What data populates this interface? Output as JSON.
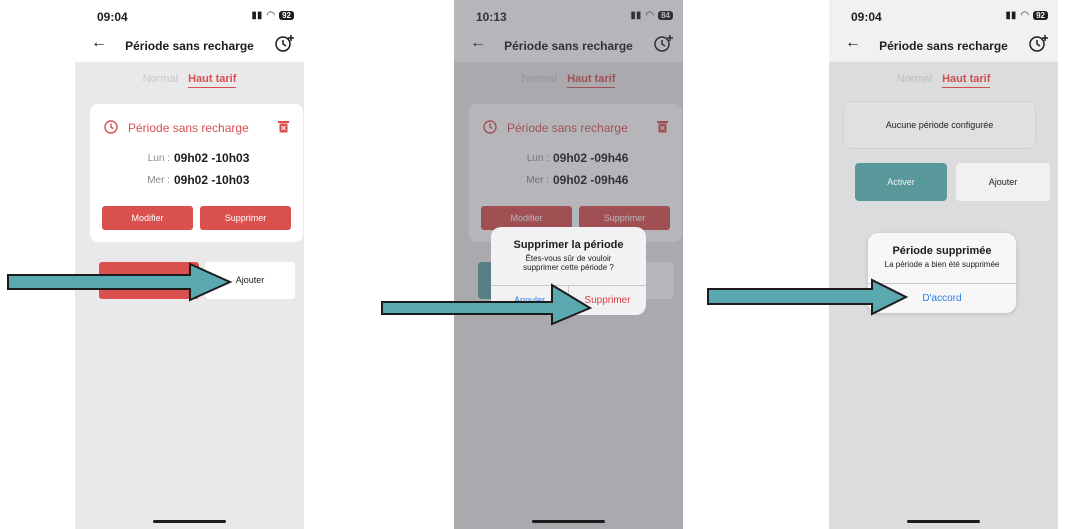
{
  "common": {
    "title": "Période sans recharge",
    "tab_normal": "Normal",
    "tab_haut": "Haut tarif",
    "card_title": "Période sans recharge",
    "day_lun": "Lun :",
    "day_mer": "Mer :"
  },
  "screen1": {
    "time": "09:04",
    "battery": "92",
    "lun_range": "09h02 -10h03",
    "mer_range": "09h02 -10h03",
    "modifier": "Modifier",
    "supprimer": "Supprimer",
    "ajouter": "Ajouter"
  },
  "screen2": {
    "time": "10:13",
    "battery": "84",
    "lun_range": "09h02 -09h46",
    "mer_range": "09h02 -09h46",
    "modifier": "Modifier",
    "supprimer": "Supprimer",
    "dialog_title": "Supprimer la période",
    "dialog_msg": "Êtes-vous sûr de vouloir supprimer cette période ?",
    "dialog_cancel": "Annuler",
    "dialog_confirm": "Supprimer"
  },
  "screen3": {
    "time": "09:04",
    "battery": "92",
    "empty": "Aucune période configurée",
    "activer": "Activer",
    "ajouter": "Ajouter",
    "dialog_title": "Période supprimée",
    "dialog_msg": "La période a bien été supprimée",
    "dialog_ok": "D'accord"
  },
  "colors": {
    "accent_red": "#d9504f",
    "teal": "#5a9fa0",
    "link_blue": "#2c7be5",
    "arrow_fill": "#5aa9b0"
  },
  "icons": [
    "back-arrow-icon",
    "clock-plus-icon",
    "clock-icon",
    "trash-icon",
    "right-arrow-icon"
  ]
}
